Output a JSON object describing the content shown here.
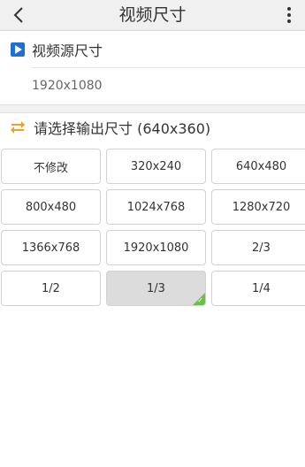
{
  "header": {
    "title": "视频尺寸",
    "back_icon": "chevron-left-icon",
    "more_icon": "more-vertical-icon"
  },
  "source": {
    "label": "视频源尺寸",
    "value": "1920x1080",
    "icon": "video-icon"
  },
  "output": {
    "label": "请选择输出尺寸 (640x360)",
    "icon": "swap-icon"
  },
  "sizes": [
    "不修改",
    "320x240",
    "640x480",
    "800x480",
    "1024x768",
    "1280x720",
    "1366x768",
    "1920x1080",
    "2/3",
    "1/2",
    "1/3",
    "1/4"
  ],
  "selected_size": "1/3",
  "colors": {
    "header_bg": "#f0f0f0",
    "video_icon": "#1e6fd0",
    "swap_icon": "#f0a020",
    "selected_bg": "#dcdcdc",
    "check": "#6cc04a"
  }
}
